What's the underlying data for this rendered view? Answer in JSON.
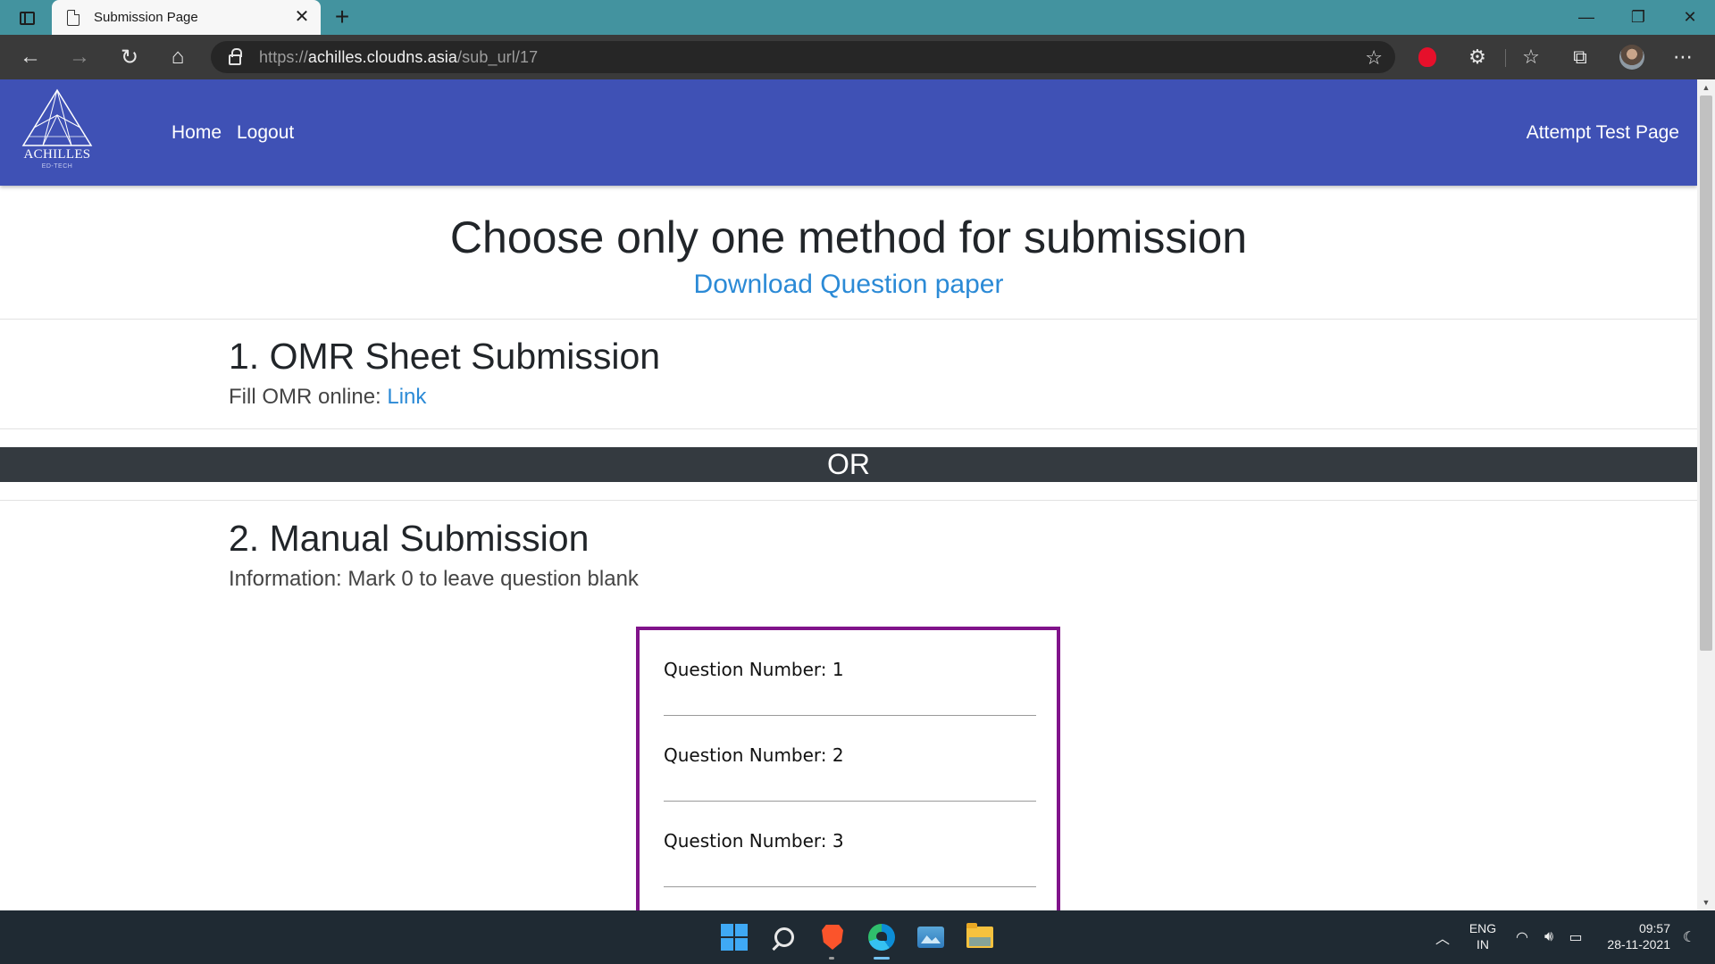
{
  "browser": {
    "tab_title": "Submission Page",
    "url_scheme": "https://",
    "url_host": "achilles.cloudns.asia",
    "url_path": "/sub_url/17"
  },
  "site": {
    "logo_name": "ACHILLES",
    "logo_sub": "ED-TECH",
    "nav": {
      "home": "Home",
      "logout": "Logout",
      "right": "Attempt Test Page"
    }
  },
  "main": {
    "heading": "Choose only one method for submission",
    "download_link": "Download Question paper",
    "omr": {
      "title": "1. OMR Sheet Submission",
      "text": "Fill OMR online: ",
      "link": "Link"
    },
    "or_label": "OR",
    "manual": {
      "title": "2. Manual Submission",
      "info": "Information: Mark 0 to leave question blank"
    },
    "questions": [
      {
        "label": "Question Number: 1"
      },
      {
        "label": "Question Number: 2"
      },
      {
        "label": "Question Number: 3"
      }
    ]
  },
  "taskbar": {
    "lang_top": "ENG",
    "lang_bottom": "IN",
    "time": "09:57",
    "date": "28-11-2021"
  },
  "colors": {
    "header": "#3f51b5",
    "or_bar": "#343a40",
    "question_border": "#80138a",
    "link": "#2b8ad6",
    "tabbar": "#43939f"
  }
}
